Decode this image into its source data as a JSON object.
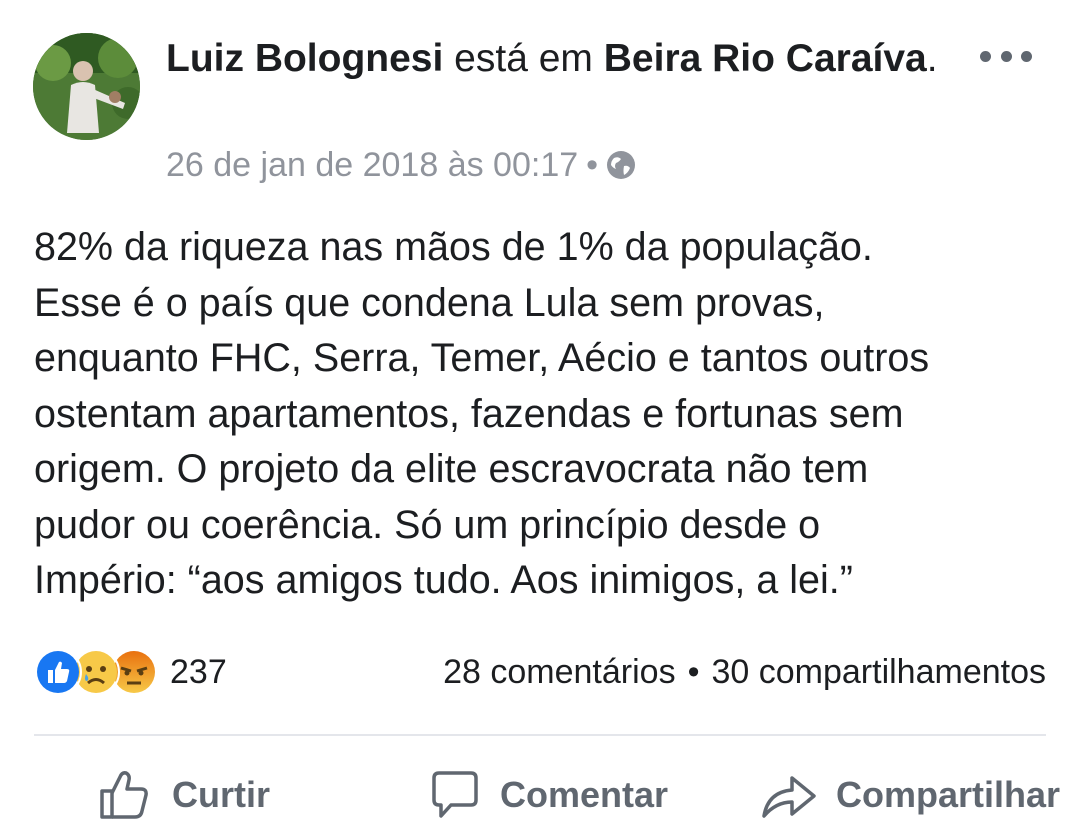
{
  "post": {
    "author_name": "Luiz Bolognesi",
    "location_prefix": "está em",
    "location_name": "Beira Rio Caraíva",
    "location_suffix": ".",
    "timestamp": "26 de jan de 2018 às 00:17",
    "meta_separator": "•",
    "privacy_icon": "globe-icon",
    "more_icon": "more-dots-icon",
    "text": "82% da riqueza nas mãos de 1% da população.\nEsse é o país que condena Lula sem provas,\nenquanto FHC, Serra, Temer, Aécio e tantos outros\nostentam apartamentos, fazendas e fortunas sem\norigem. O projeto da elite escravocrata não tem\npudor ou coerência. Só um princípio desde o\nImpério: “aos amigos tudo. Aos inimigos, a lei.”"
  },
  "engagement": {
    "reaction_icons": [
      "like-icon",
      "sad-icon",
      "angry-icon"
    ],
    "reaction_count": "237",
    "comments": "28 comentários",
    "separator": "•",
    "shares": "30 compartilhamentos"
  },
  "actions": {
    "like_label": "Curtir",
    "comment_label": "Comentar",
    "share_label": "Compartilhar"
  },
  "colors": {
    "text_primary": "#1c1e21",
    "text_secondary": "#90949c",
    "action_gray": "#606770",
    "like_blue": "#1877f2",
    "sad_yellow": "#f7c948",
    "angry_orange": "#e9710f"
  }
}
